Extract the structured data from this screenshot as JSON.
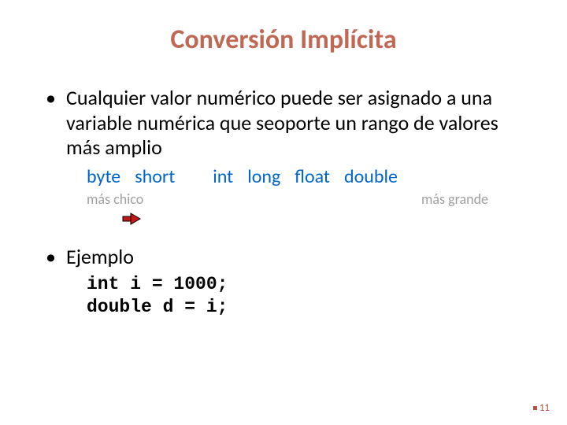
{
  "title": "Conversión Implícita",
  "bullet1": "Cualquier valor numérico puede ser asignado a una variable numérica que seoporte un rango de valores más amplio",
  "types": {
    "t0": "byte",
    "t1": "short",
    "t2": "int",
    "t3": "long",
    "t4": "float",
    "t5": "double"
  },
  "labels": {
    "small": "más chico",
    "large": "más grande"
  },
  "bullet2": "Ejemplo",
  "code": {
    "line1": "int i = 1000;",
    "line2": "double d = i;"
  },
  "page": "11"
}
